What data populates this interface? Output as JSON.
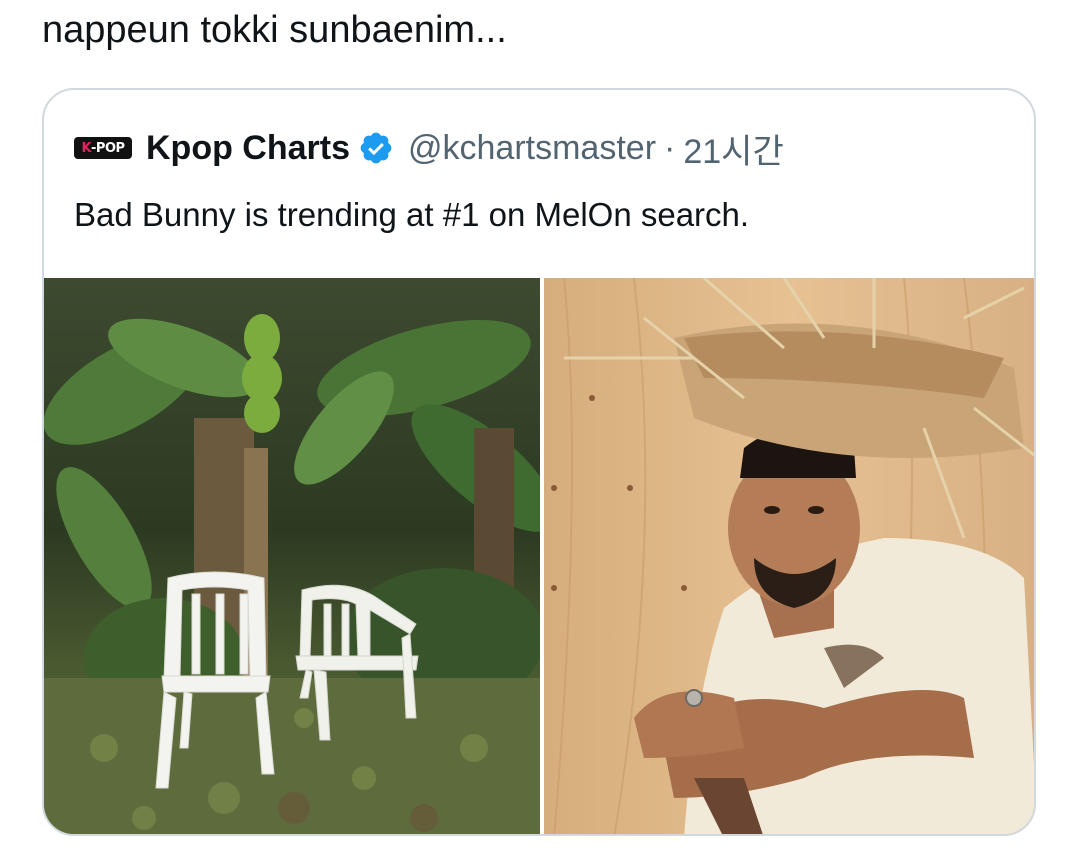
{
  "tweet": {
    "text": "nappeun tokki sunbaenim..."
  },
  "quote": {
    "logo_text": "K-POP",
    "display_name": "Kpop Charts",
    "handle": "@kchartsmaster",
    "separator": "·",
    "time": "21시간",
    "text": "Bad Bunny is trending at #1 on MelOn search."
  },
  "media": {
    "left": {
      "alt": "two-white-plastic-chairs-in-banana-grove"
    },
    "right": {
      "alt": "man-in-straw-hat-leaning-on-chair"
    }
  },
  "colors": {
    "verified": "#1d9bf0",
    "border": "#cfd9de",
    "secondary_text": "#536471"
  },
  "icons": {
    "verified": "verified-badge-icon"
  }
}
